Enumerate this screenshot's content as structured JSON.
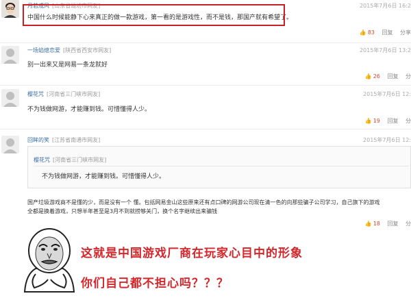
{
  "comments": [
    {
      "username": "月若成风",
      "location": "[山东省潍坊市网友]",
      "time": "2015年7月6日 16:2",
      "text": "中国什么时候能静下心来真正的做一款游戏，第一看的是游戏性，而不是钱，那国产就有希望了。",
      "likes": "83",
      "reply": "回复",
      "share": "分享"
    },
    {
      "username": "一场焰熄恋爱",
      "location": "[陕西省西安市网友]",
      "time": "2015年7月6日 13:2",
      "text": "别一出来又是网易一条龙就好",
      "likes": "26",
      "reply": "回复",
      "share": "分"
    },
    {
      "username": "樱花咒",
      "location": "[河南省三门峡市网友]",
      "time": "2015年7月6日 12:",
      "text": "不为钱做网游，才能赚到钱。可惜懂得人少。",
      "likes": "19",
      "reply": "回复",
      "share": "分"
    },
    {
      "username": "回眸的笑",
      "location": "[江苏省南通市网友]",
      "time": "2015年7月6日 12:",
      "quote": {
        "username": "樱花咒",
        "location": "[河南省三门峡市网友]",
        "text": "不为钱做网游，才能赚到钱。可惜懂得人少。"
      },
      "text_lines": [
        "国产垃圾游戏商不是懂的少，而是没有一个 懂。包括网易金山这些原来还有点口碑的网游公司现在清一色的向那些骗子公司学习，自己旗下的游戏",
        "全都是换着游戏，只想半年甚至是3月不到就捞够关门，换个名字继续出来骗钱"
      ],
      "likes": "18",
      "reply": "回复",
      "share": "分"
    }
  ],
  "caption": {
    "line1": "这就是中国游戏厂商在玩家心目中的形象",
    "line2": "你们自己都不担心吗？？？"
  },
  "colors": {
    "highlight": "#c91f24",
    "caption": "#d4262b",
    "username": "#3a6ea5",
    "like": "#d04a2c"
  }
}
